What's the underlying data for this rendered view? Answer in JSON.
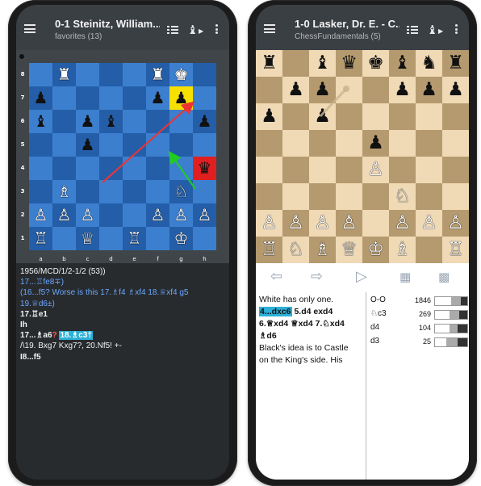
{
  "left_phone": {
    "title": "0-1 Steinitz, William...",
    "subtitle": "favorites (13)",
    "board": {
      "ranks": [
        "8",
        "7",
        "6",
        "5",
        "4",
        "3",
        "2",
        "1"
      ],
      "files": [
        "a",
        "b",
        "c",
        "d",
        "e",
        "f",
        "g",
        "h"
      ],
      "pieces": [
        {
          "p": "♜",
          "sq": "b8",
          "c": "w"
        },
        {
          "p": "♜",
          "sq": "f8",
          "c": "w"
        },
        {
          "p": "♚",
          "sq": "g8",
          "c": "w"
        },
        {
          "p": "♟",
          "sq": "a7",
          "c": "b"
        },
        {
          "p": "♟",
          "sq": "f7",
          "c": "b"
        },
        {
          "p": "♟",
          "sq": "g7",
          "c": "b"
        },
        {
          "p": "♝",
          "sq": "a6",
          "c": "b"
        },
        {
          "p": "♟",
          "sq": "c6",
          "c": "b"
        },
        {
          "p": "♝",
          "sq": "d6",
          "c": "b"
        },
        {
          "p": "♟",
          "sq": "h6",
          "c": "b"
        },
        {
          "p": "♟",
          "sq": "c5",
          "c": "b"
        },
        {
          "p": "♛",
          "sq": "h4",
          "c": "b"
        },
        {
          "p": "♗",
          "sq": "b3",
          "c": "w"
        },
        {
          "p": "♘",
          "sq": "g3",
          "c": "w"
        },
        {
          "p": "♙",
          "sq": "a2",
          "c": "w"
        },
        {
          "p": "♙",
          "sq": "b2",
          "c": "w"
        },
        {
          "p": "♙",
          "sq": "c2",
          "c": "w"
        },
        {
          "p": "♙",
          "sq": "f2",
          "c": "w"
        },
        {
          "p": "♙",
          "sq": "g2",
          "c": "w"
        },
        {
          "p": "♙",
          "sq": "h2",
          "c": "w"
        },
        {
          "p": "♖",
          "sq": "a1",
          "c": "w"
        },
        {
          "p": "♕",
          "sq": "c1",
          "c": "w"
        },
        {
          "p": "♖",
          "sq": "e1",
          "c": "w"
        },
        {
          "p": "♔",
          "sq": "g1",
          "c": "w"
        }
      ]
    },
    "notation": [
      "1956/MCD/1/2-1/2 (53))",
      "17...♖fe8∓)",
      "(16...f5? Worse is this 17.♗f4 ♗xf4 18.♕xf4 g5",
      "19.♕d6±)",
      "17.♖e1",
      "Ih",
      "17...♗a6? 18.♗c3†",
      "/\\19. Bxg7 Kxg7?, 20.Nf5! +-",
      "I8...f5"
    ]
  },
  "right_phone": {
    "title": "1-0 Lasker, Dr. E. - C...",
    "subtitle": "ChessFundamentals (5)",
    "board": {
      "pieces": [
        {
          "p": "♜",
          "sq": "a8",
          "c": "b"
        },
        {
          "p": "♝",
          "sq": "c8",
          "c": "b"
        },
        {
          "p": "♛",
          "sq": "d8",
          "c": "b"
        },
        {
          "p": "♚",
          "sq": "e8",
          "c": "b"
        },
        {
          "p": "♝",
          "sq": "f8",
          "c": "b"
        },
        {
          "p": "♞",
          "sq": "g8",
          "c": "b"
        },
        {
          "p": "♜",
          "sq": "h8",
          "c": "b"
        },
        {
          "p": "♟",
          "sq": "b7",
          "c": "b"
        },
        {
          "p": "♟",
          "sq": "c7",
          "c": "b"
        },
        {
          "p": "♟",
          "sq": "f7",
          "c": "b"
        },
        {
          "p": "♟",
          "sq": "g7",
          "c": "b"
        },
        {
          "p": "♟",
          "sq": "h7",
          "c": "b"
        },
        {
          "p": "♟",
          "sq": "a6",
          "c": "b"
        },
        {
          "p": "♟",
          "sq": "c6",
          "c": "b"
        },
        {
          "p": "♟",
          "sq": "e5",
          "c": "b"
        },
        {
          "p": "♙",
          "sq": "e4",
          "c": "w"
        },
        {
          "p": "♘",
          "sq": "f3",
          "c": "w"
        },
        {
          "p": "♙",
          "sq": "a2",
          "c": "w"
        },
        {
          "p": "♙",
          "sq": "b2",
          "c": "w"
        },
        {
          "p": "♙",
          "sq": "c2",
          "c": "w"
        },
        {
          "p": "♙",
          "sq": "d2",
          "c": "w"
        },
        {
          "p": "♙",
          "sq": "f2",
          "c": "w"
        },
        {
          "p": "♙",
          "sq": "g2",
          "c": "w"
        },
        {
          "p": "♙",
          "sq": "h2",
          "c": "w"
        },
        {
          "p": "♖",
          "sq": "a1",
          "c": "w"
        },
        {
          "p": "♘",
          "sq": "b1",
          "c": "w"
        },
        {
          "p": "♗",
          "sq": "c1",
          "c": "w"
        },
        {
          "p": "♕",
          "sq": "d1",
          "c": "w"
        },
        {
          "p": "♔",
          "sq": "e1",
          "c": "w"
        },
        {
          "p": "♗",
          "sq": "f1",
          "c": "w"
        },
        {
          "p": "♖",
          "sq": "h1",
          "c": "w"
        }
      ]
    },
    "comment_lines": [
      "White has only one.",
      "4...dxc6 5.d4 exd4",
      "6.♕xd4 ♕xd4 7.♘xd4",
      "♗d6",
      "Black's idea is to Castle",
      "on the King's side. His"
    ],
    "stats": [
      {
        "move": "O-O",
        "count": "1846",
        "w": 0.5,
        "d": 0.3,
        "b": 0.2
      },
      {
        "move": "♘c3",
        "count": "269",
        "w": 0.45,
        "d": 0.3,
        "b": 0.25
      },
      {
        "move": "d4",
        "count": "104",
        "w": 0.45,
        "d": 0.25,
        "b": 0.3
      },
      {
        "move": "d3",
        "count": "25",
        "w": 0.35,
        "d": 0.35,
        "b": 0.3
      }
    ]
  },
  "colors": {
    "left_light": "#3c7fcf",
    "left_dark": "#245ea8",
    "right_light": "#f0d9b5",
    "right_dark": "#b49a6e",
    "highlight": "#f6e000",
    "check": "#e02020"
  }
}
